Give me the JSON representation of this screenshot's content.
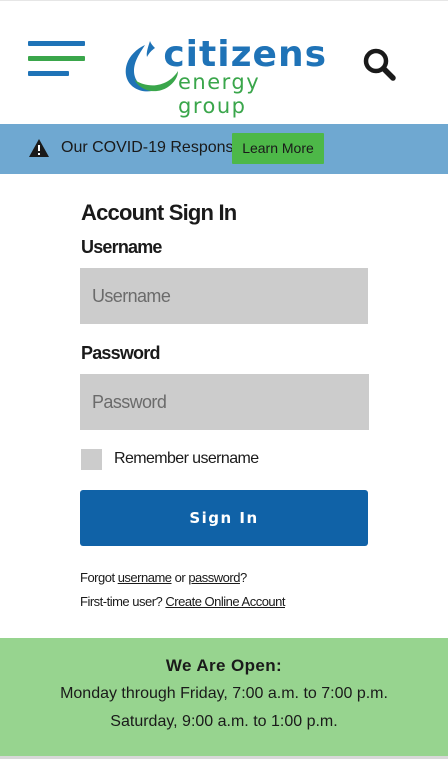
{
  "header": {
    "logo": {
      "word1": "citizens",
      "word2": "energy group"
    },
    "icons": {
      "menu": "hamburger-menu-icon",
      "search": "search-icon"
    },
    "colors": {
      "brand_blue": "#1f73b7",
      "brand_green": "#3aa64b"
    }
  },
  "covid_banner": {
    "icon": "warning-icon",
    "text": "Our COVID-19 Response",
    "button_label": "Learn More",
    "background": "#6fa8d1",
    "button_color": "#4db848"
  },
  "signin": {
    "title": "Account Sign In",
    "username_label": "Username",
    "username_placeholder": "Username",
    "username_value": "",
    "password_label": "Password",
    "password_placeholder": "Password",
    "password_value": "",
    "remember_label": "Remember username",
    "remember_checked": false,
    "button_label": "Sign In",
    "button_color": "#1062a7",
    "forgot_prefix": "Forgot",
    "forgot_username_link": "username",
    "forgot_or": "or",
    "forgot_password_link": "password",
    "forgot_suffix": "?",
    "first_time_prefix": "First-time user?",
    "create_account_link": "Create Online Account"
  },
  "hours": {
    "title": "We Are Open:",
    "weekday": "Monday through Friday, 7:00 a.m. to 7:00 p.m.",
    "saturday": "Saturday, 9:00 a.m. to 1:00 p.m.",
    "background": "#97d48f"
  }
}
